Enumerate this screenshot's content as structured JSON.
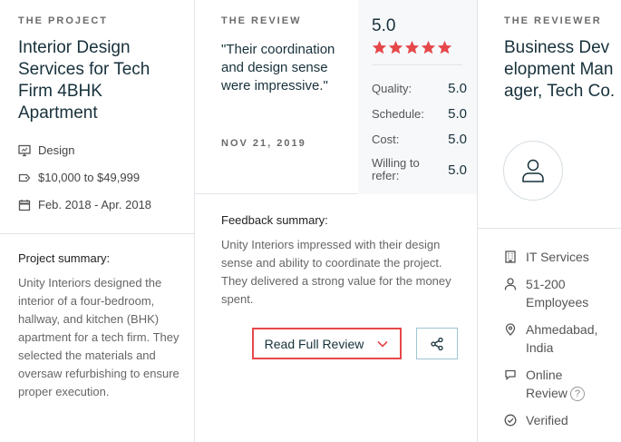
{
  "project": {
    "eyebrow": "THE PROJECT",
    "title": "Interior Design Services for Tech Firm 4BHK Apartment",
    "service": "Design",
    "budget": "$10,000 to $49,999",
    "dates": "Feb. 2018 - Apr. 2018",
    "summary_label": "Project summary:",
    "summary_text": "Unity Interiors designed the interior of a four-bedroom, hallway, and kitchen (BHK) apartment for a tech firm. They selected the materials and oversaw refurbishing to ensure proper execution."
  },
  "review": {
    "eyebrow": "THE REVIEW",
    "quote": "\"Their coordination and design sense were impressive.\"",
    "date": "NOV 21, 2019",
    "overall": "5.0",
    "stars": 5,
    "ratings": [
      {
        "label": "Quality:",
        "value": "5.0"
      },
      {
        "label": "Schedule:",
        "value": "5.0"
      },
      {
        "label": "Cost:",
        "value": "5.0"
      },
      {
        "label": "Willing to refer:",
        "value": "5.0"
      }
    ],
    "feedback_label": "Feedback summary:",
    "feedback_text": "Unity Interiors impressed with their design sense and ability to coordinate the project. They delivered a strong value for the money spent.",
    "read_button": "Read Full Review"
  },
  "reviewer": {
    "eyebrow": "THE REVIEWER",
    "title": "Business Development Manager, Tech Co.",
    "industry": "IT Services",
    "employees": "51-200 Employees",
    "location": "Ahmedabad, India",
    "review_type": "Online Review",
    "help_mark": "?",
    "verified": "Verified"
  },
  "colors": {
    "accent_red": "#e6474a",
    "title_navy": "#17313b",
    "border": "#e1e4e8"
  },
  "icons": {
    "service": "monitor-icon",
    "budget": "price-tag-icon",
    "dates": "calendar-icon",
    "avatar": "user-icon",
    "industry": "building-icon",
    "employees": "person-icon",
    "location": "map-pin-icon",
    "review_type": "chat-icon",
    "verified": "check-circle-icon",
    "share": "share-icon",
    "expand": "chevron-down-icon"
  }
}
